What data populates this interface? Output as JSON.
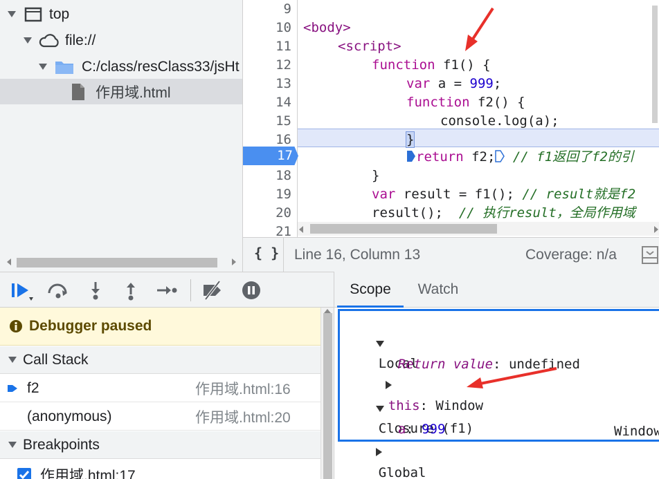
{
  "file_tree": {
    "items": [
      {
        "label": "top",
        "icon": "window-icon"
      },
      {
        "label": "file://",
        "icon": "cloud-icon"
      },
      {
        "label": "C:/class/resClass33/jsHt",
        "icon": "folder-icon"
      },
      {
        "label": "作用域.html",
        "icon": "file-icon"
      }
    ]
  },
  "editor": {
    "line_numbers": [
      "9",
      "10",
      "11",
      "12",
      "13",
      "14",
      "15",
      "16",
      "17",
      "18",
      "19",
      "20",
      "21"
    ],
    "breakpoint_line": "17",
    "highlighted_line": "16",
    "code": {
      "l10": "<body>",
      "l11_tag": "<script>",
      "l12_kw": "function",
      "l12_rest": " f1() {",
      "l13_kw": "var",
      "l13_mid": " a = ",
      "l13_num": "999",
      "l13_end": ";",
      "l14_kw": "function",
      "l14_rest": " f2() {",
      "l15": "console.log(a);",
      "l16": "}",
      "l17_kw": "return",
      "l17_rest": " f2;",
      "l17_cmt": " // f1返回了f2的引",
      "l18": "}",
      "l19_kw": "var",
      "l19_rest": " result = f1();",
      "l19_cmt": " // result就是f2",
      "l20_rest": "result();",
      "l20_cmt": "  // 执行result，全局作用域"
    }
  },
  "status_bar": {
    "format_icon": "{ }",
    "position": "Line 16, Column 13",
    "coverage": "Coverage: n/a"
  },
  "debugger": {
    "paused_message": "Debugger paused",
    "call_stack_header": "Call Stack",
    "call_stack": [
      {
        "name": "f2",
        "location": "作用域.html:16",
        "current": true
      },
      {
        "name": "(anonymous)",
        "location": "作用域.html:20",
        "current": false
      }
    ],
    "breakpoints_header": "Breakpoints",
    "breakpoints": [
      {
        "label": "作用域.html:17",
        "checked": true
      }
    ]
  },
  "scope": {
    "tabs": [
      "Scope",
      "Watch"
    ],
    "active_tab": "Scope",
    "local_label": "Local",
    "return_key": "Return value",
    "return_value": "undefined",
    "this_key": "this",
    "this_value": "Window",
    "closure_label": "Closure (f1)",
    "a_key": "a",
    "a_value": "999",
    "global_label": "Global",
    "global_value": "Window"
  },
  "colors": {
    "accent": "#1a73e8",
    "breakpoint": "#4a8ff0",
    "annotation_arrow": "#e8302a",
    "paused_banner": "#fff9db"
  }
}
